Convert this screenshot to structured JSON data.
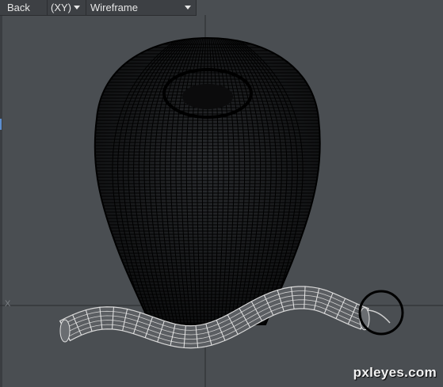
{
  "toolbar": {
    "view_label": "Back",
    "axis_label": "(XY)",
    "mode_label": "Wireframe"
  },
  "axis": {
    "x_label": "X"
  },
  "watermark": "pxleyes.com",
  "colors": {
    "viewport_bg": "#4a4e52",
    "toolbar_bg": "#3d4044",
    "wire_dark": "#000000",
    "wire_light": "#d8d8d8",
    "axis_line": "#2a2c2f"
  },
  "icons": {
    "dropdown": "chevron-down-icon",
    "selection_circle": "circle-icon"
  }
}
